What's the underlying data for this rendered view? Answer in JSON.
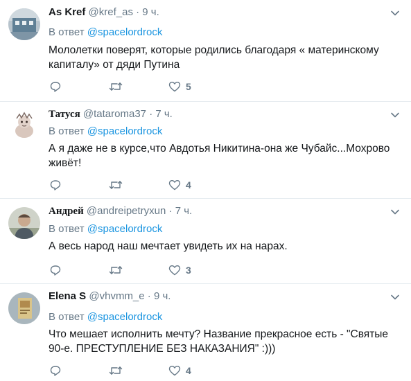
{
  "tweets": [
    {
      "name": "As Kref",
      "handle": "@kref_as",
      "time": "9 ч.",
      "reply_prefix": "В ответ",
      "reply_to": "@spacelordrock",
      "text": "Мололетки поверят, которые родились благодаря « материнскому капиталу» от дяди Путина",
      "likes": "5"
    },
    {
      "name": "Татуся",
      "handle": "@tataroma37",
      "time": "7 ч.",
      "reply_prefix": "В ответ",
      "reply_to": "@spacelordrock",
      "text": "А я даже не в курсе,что Авдотья Никитина-она же Чубайс...Мохрово живёт!",
      "likes": "4"
    },
    {
      "name": "Андрей",
      "handle": "@andreipetryxun",
      "time": "7 ч.",
      "reply_prefix": "В ответ",
      "reply_to": "@spacelordrock",
      "text": "А  весь народ наш мечтает увидеть их на нарах.",
      "likes": "3"
    },
    {
      "name": "Elena S",
      "handle": "@vhvmm_e",
      "time": "9 ч.",
      "reply_prefix": "В ответ",
      "reply_to": "@spacelordrock",
      "text": "Что мешает исполнить мечту? Название прекрасное есть - \"Святые 90-е. ПРЕСТУПЛЕНИЕ БЕЗ НАКАЗАНИЯ\" :)))",
      "likes": "4"
    }
  ],
  "separator": "·",
  "colors": {
    "accent": "#1b95e0",
    "muted": "#657786",
    "text": "#14171a",
    "border": "#e6ecf0"
  },
  "icons": [
    "reply-icon",
    "retweet-icon",
    "like-icon",
    "chevron-down-icon"
  ]
}
